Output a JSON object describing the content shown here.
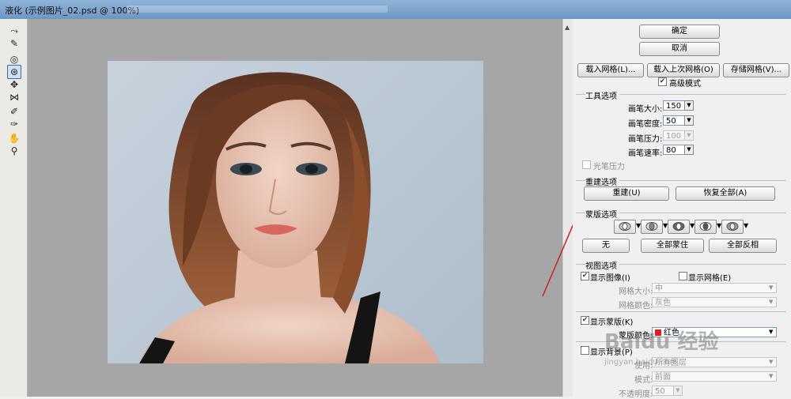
{
  "window": {
    "title": "液化 (示例图片_02.psd @ 100%)"
  },
  "tools": [
    {
      "name": "forward-warp-tool-icon",
      "glyph": "⤳"
    },
    {
      "name": "reconstruct-tool-icon",
      "glyph": "✎"
    },
    {
      "name": "twirl-tool-icon",
      "glyph": "◎"
    },
    {
      "name": "pucker-tool-icon",
      "glyph": "⊛"
    },
    {
      "name": "bloat-tool-icon",
      "glyph": "✥"
    },
    {
      "name": "push-left-tool-icon",
      "glyph": "⋈"
    },
    {
      "name": "freeze-mask-tool-icon",
      "glyph": "✐"
    },
    {
      "name": "thaw-mask-tool-icon",
      "glyph": "✑"
    },
    {
      "name": "hand-tool-icon",
      "glyph": "✋"
    },
    {
      "name": "zoom-tool-icon",
      "glyph": "⚲"
    }
  ],
  "panel": {
    "ok": "确定",
    "cancel": "取消",
    "load_mesh": "载入网格(L)...",
    "load_last_mesh": "载入上次网格(O)",
    "save_mesh": "存储网格(V)...",
    "advanced_mode": "高级模式",
    "tool_options": {
      "title": "工具选项",
      "brush_size_label": "画笔大小:",
      "brush_size": "150",
      "brush_density_label": "画笔密度:",
      "brush_density": "50",
      "brush_pressure_label": "画笔压力:",
      "brush_pressure": "100",
      "brush_rate_label": "画笔速率:",
      "brush_rate": "80",
      "stylus_pressure": "光笔压力"
    },
    "reconstruct_options": {
      "title": "重建选项",
      "reconstruct": "重建(U)",
      "restore_all": "恢复全部(A)"
    },
    "mask_options": {
      "title": "蒙版选项",
      "none": "无",
      "mask_all": "全部蒙住",
      "invert_all": "全部反相"
    },
    "view_options": {
      "title": "视图选项",
      "show_image": "显示图像(I)",
      "show_mesh": "显示网格(E)",
      "mesh_size_label": "网格大小:",
      "mesh_size": "中",
      "mesh_color_label": "网格颜色:",
      "mesh_color": "灰色",
      "show_mask": "显示蒙版(K)",
      "mask_color_label": "蒙版颜色:",
      "mask_color": "红色",
      "show_backdrop": "显示背景(P)",
      "use_label": "使用:",
      "use": "所有图层",
      "mode_label": "模式:",
      "mode": "前面",
      "opacity_label": "不透明度:",
      "opacity": "50"
    }
  },
  "watermark": {
    "brand": "Baidu 经验",
    "url": "jingyan.baidu.com"
  },
  "colors": {
    "annotation_arrow": "#cc1f1f",
    "canvas_bg": "#a6a6a6",
    "panel_bg": "#f0f0f0"
  }
}
